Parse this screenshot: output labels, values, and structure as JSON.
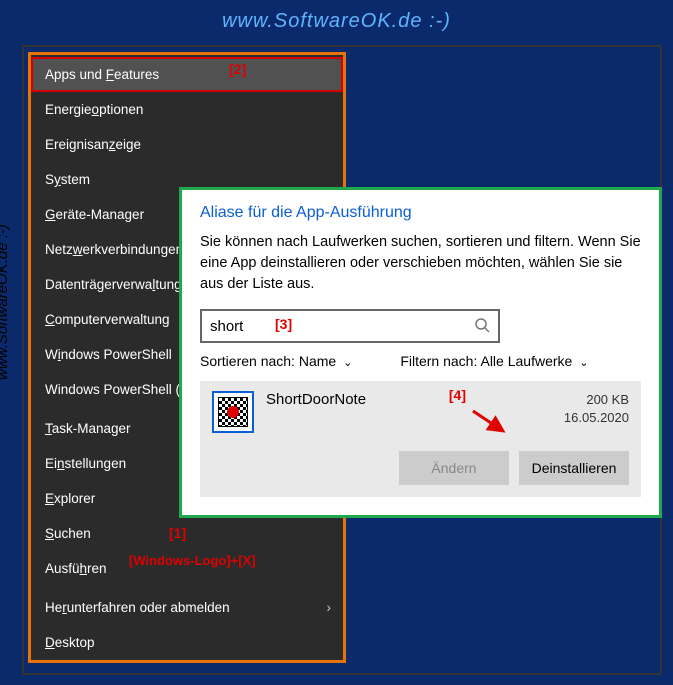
{
  "header": {
    "site": "www.SoftwareOK.de :-)"
  },
  "sidetext": "www.SoftwareOK.de :-)",
  "annotations": {
    "a1": "[1]",
    "a2": "[2]",
    "a3": "[3]",
    "a4": "[4]",
    "shortcut": "[Windows-Logo]+[X]"
  },
  "menu": {
    "items": [
      "Apps und Features",
      "Energieoptionen",
      "Ereignisanzeige",
      "System",
      "Geräte-Manager",
      "Netzwerkverbindungen",
      "Datenträgerverwaltung",
      "Computerverwaltung",
      "Windows PowerShell",
      "Windows PowerShell (Administrator)",
      "Task-Manager",
      "Einstellungen",
      "Explorer",
      "Suchen",
      "Ausführen",
      "Herunterfahren oder abmelden",
      "Desktop"
    ]
  },
  "dialog": {
    "title": "Aliase für die App-Ausführung",
    "description": "Sie können nach Laufwerken suchen, sortieren und filtern. Wenn Sie eine App deinstallieren oder verschieben möchten, wählen Sie sie aus der Liste aus.",
    "search_value": "short",
    "sort_label": "Sortieren nach:",
    "sort_value": "Name",
    "filter_label": "Filtern nach:",
    "filter_value": "Alle Laufwerke",
    "app": {
      "name": "ShortDoorNote",
      "size": "200 KB",
      "date": "16.05.2020"
    },
    "buttons": {
      "change": "Ändern",
      "uninstall": "Deinstallieren"
    }
  }
}
